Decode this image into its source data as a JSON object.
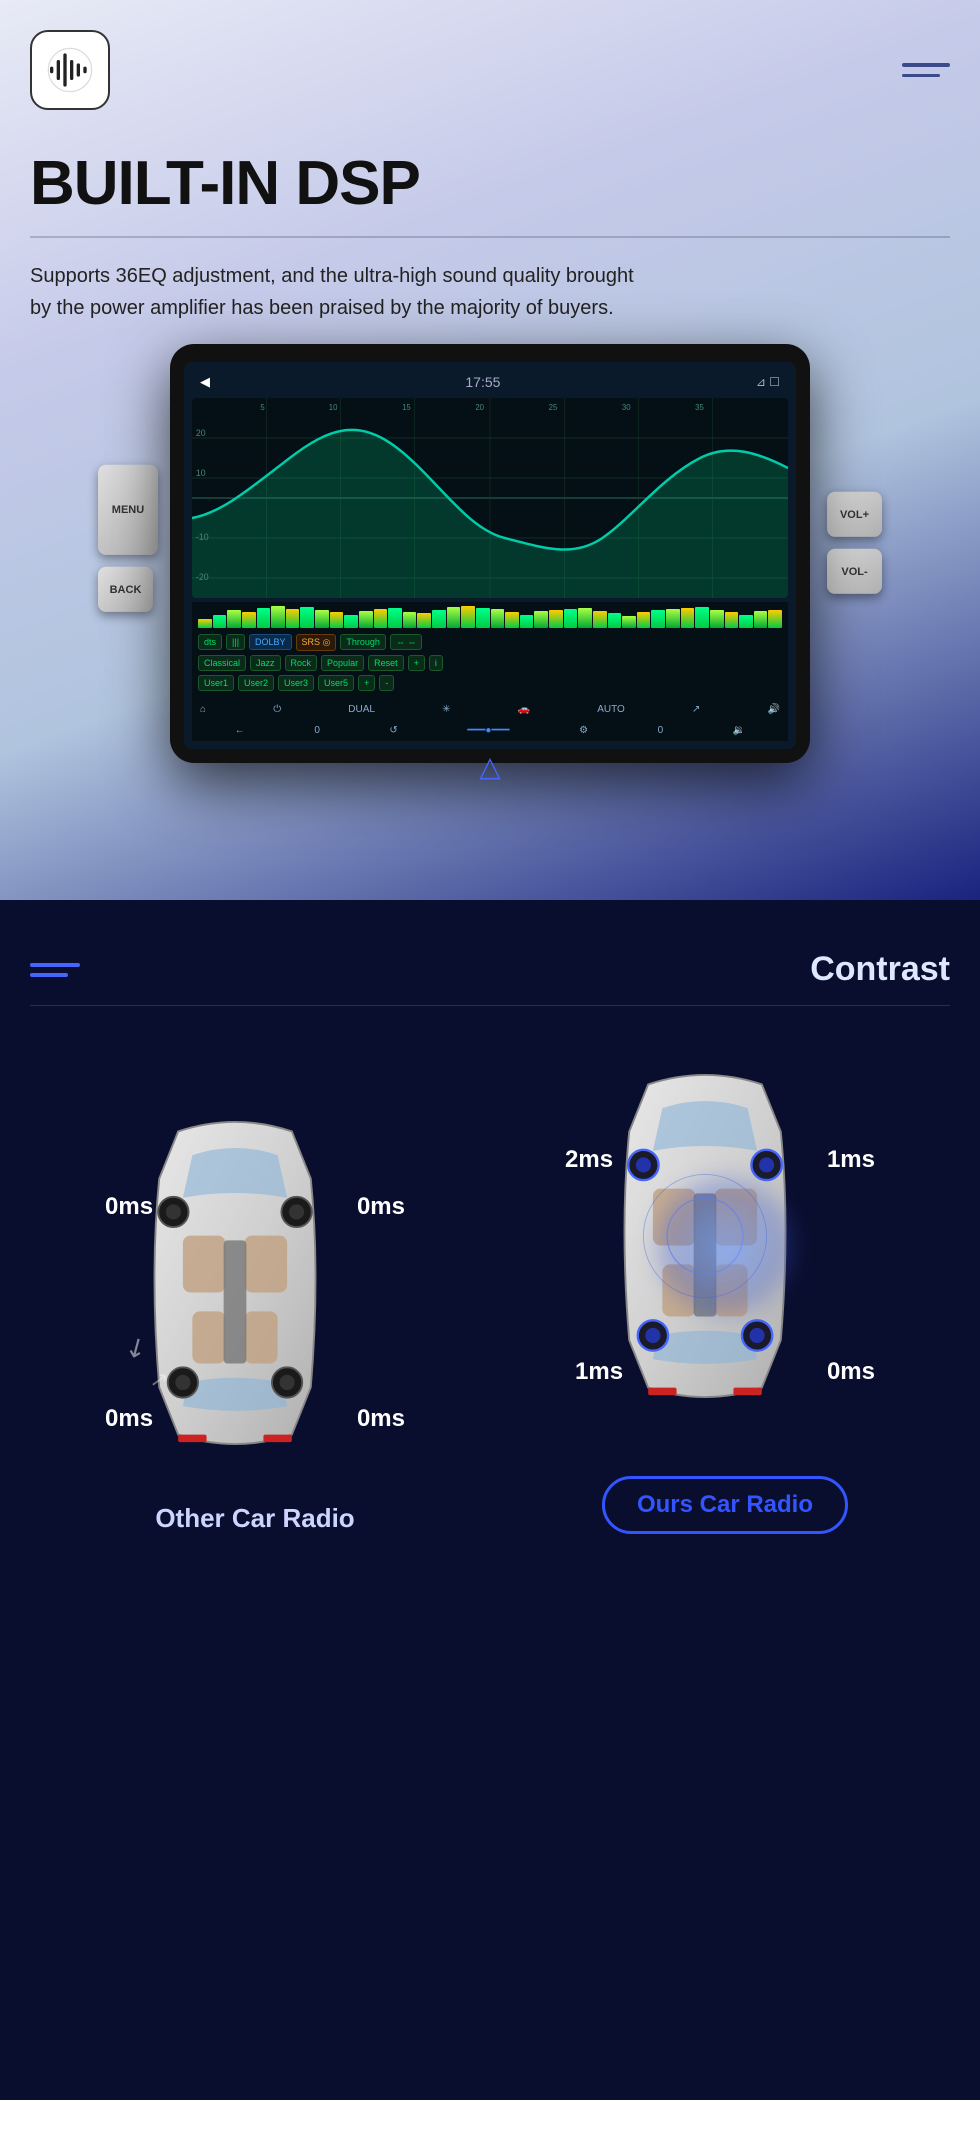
{
  "header": {
    "logo_alt": "Audio Logo",
    "menu_label": "Menu"
  },
  "hero": {
    "title": "BUILT-IN DSP",
    "subtitle": "Supports 36EQ adjustment, and the ultra-high sound quality brought by the power amplifier has been praised by the majority of buyers.",
    "divider": true
  },
  "screen_ui": {
    "time": "17:55",
    "dual_label": "DUAL",
    "auto_label": "AUTO",
    "eq_presets": [
      "Classical",
      "Jazz",
      "Rock",
      "Popular",
      "Reset"
    ],
    "eq_users": [
      "User1",
      "User2",
      "User3",
      "User5"
    ],
    "eq_modes": [
      "DTS",
      "BBE",
      "DOLBY",
      "SRS",
      "Through"
    ],
    "nav_back": "←",
    "nav_forward": "→"
  },
  "side_buttons": {
    "left": [
      {
        "label": "MENU"
      },
      {
        "label": "BACK"
      }
    ],
    "right": [
      {
        "label": "VOL+"
      },
      {
        "label": "VOL-"
      }
    ]
  },
  "contrast_section": {
    "title": "Contrast",
    "left_car": {
      "label": "Other Car Radio",
      "ms_values": {
        "top_left": "0ms",
        "top_right": "0ms",
        "bottom_left": "0ms",
        "bottom_right": "0ms"
      }
    },
    "right_car": {
      "label": "Ours Car Radio",
      "ms_values": {
        "top_left": "2ms",
        "top_right": "1ms",
        "bottom_left": "1ms",
        "bottom_right": "0ms"
      }
    }
  }
}
